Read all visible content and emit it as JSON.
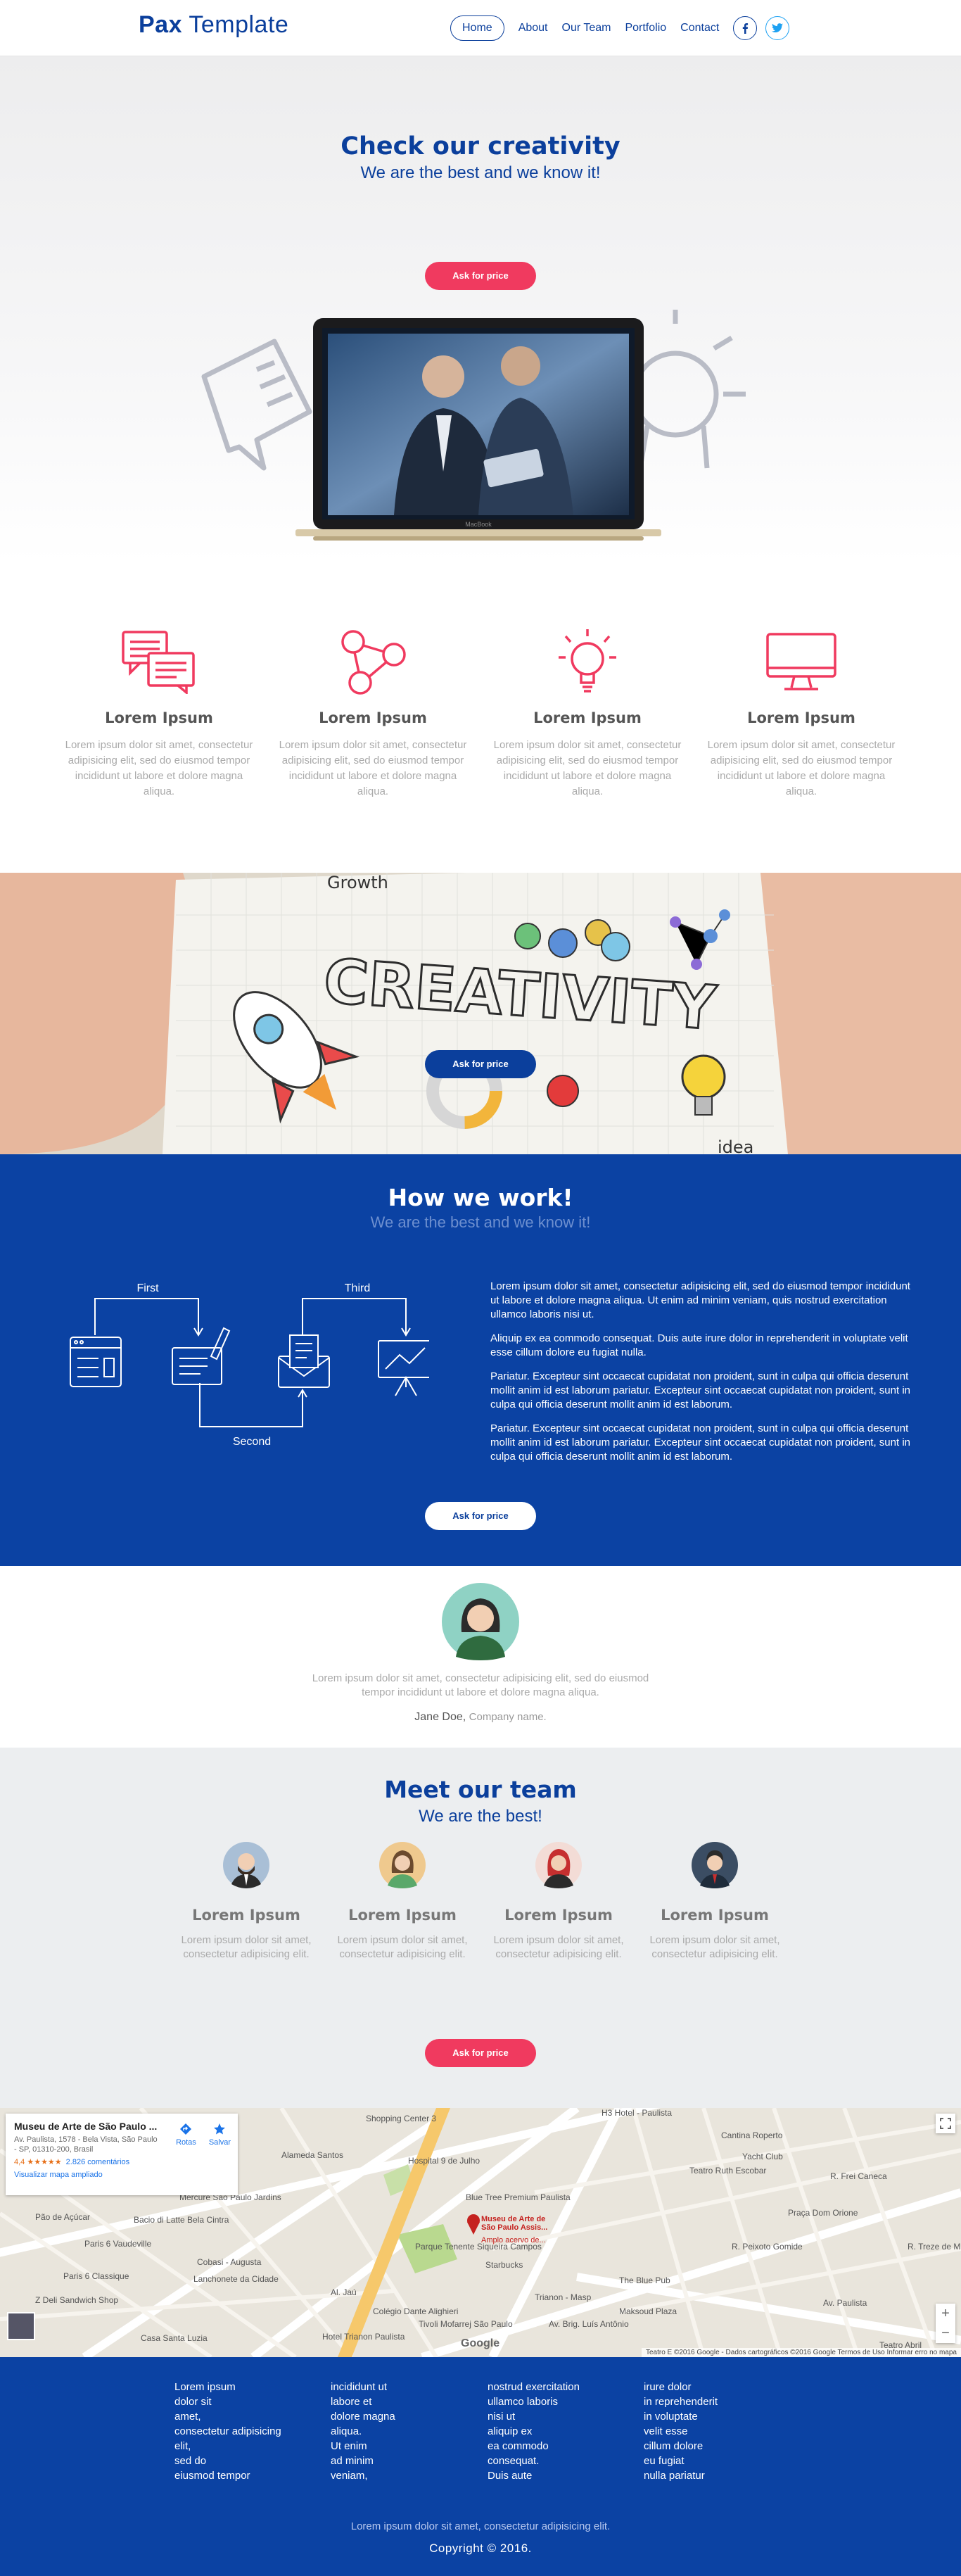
{
  "nav": {
    "logo_bold": "Pax",
    "logo_light": "Template",
    "items": [
      {
        "label": "Home"
      },
      {
        "label": "About"
      },
      {
        "label": "Our Team"
      },
      {
        "label": "Portfolio"
      },
      {
        "label": "Contact"
      }
    ],
    "social": [
      "facebook-icon",
      "twitter-icon"
    ]
  },
  "hero": {
    "title": "Check our creativity",
    "subtitle": "We are the best and we know it!",
    "cta": "Ask for price",
    "laptop_brand": "MacBook"
  },
  "features": [
    {
      "icon": "chat-bubbles-icon",
      "title": "Lorem Ipsum",
      "text": "Lorem ipsum dolor sit amet, consectetur adipisicing elit, sed do eiusmod tempor incididunt ut labore et dolore magna aliqua."
    },
    {
      "icon": "share-nodes-icon",
      "title": "Lorem Ipsum",
      "text": "Lorem ipsum dolor sit amet, consectetur adipisicing elit, sed do eiusmod tempor incididunt ut labore et dolore magna aliqua."
    },
    {
      "icon": "lightbulb-icon",
      "title": "Lorem Ipsum",
      "text": "Lorem ipsum dolor sit amet, consectetur adipisicing elit, sed do eiusmod tempor incididunt ut labore et dolore magna aliqua."
    },
    {
      "icon": "monitor-icon",
      "title": "Lorem Ipsum",
      "text": "Lorem ipsum dolor sit amet, consectetur adipisicing elit, sed do eiusmod tempor incididunt ut labore et dolore magna aliqua."
    }
  ],
  "banner": {
    "word": "CREATIVITY",
    "corner_word": "Growth",
    "corner_word_2": "idea",
    "cta": "Ask for price"
  },
  "how": {
    "title": "How we work!",
    "subtitle": "We are the best and we know it!",
    "steps": {
      "first": "First",
      "second": "Second",
      "third": "Third"
    },
    "paragraphs": [
      "Lorem ipsum dolor sit amet, consectetur adipisicing elit, sed do eiusmod tempor incididunt ut labore et dolore magna aliqua. Ut enim ad minim veniam, quis nostrud exercitation ullamco laboris nisi ut.",
      "Aliquip ex ea commodo consequat. Duis aute irure dolor in reprehenderit in voluptate velit esse cillum dolore eu fugiat nulla.",
      "Pariatur. Excepteur sint occaecat cupidatat non proident, sunt in culpa qui officia deserunt mollit anim id est laborum pariatur. Excepteur sint occaecat cupidatat non proident, sunt in culpa qui officia deserunt mollit anim id est laborum.",
      "Pariatur. Excepteur sint occaecat cupidatat non proident, sunt in culpa qui officia deserunt mollit anim id est laborum pariatur. Excepteur sint occaecat cupidatat non proident, sunt in culpa qui officia deserunt mollit anim id est laborum."
    ],
    "cta": "Ask for price"
  },
  "testimonial": {
    "quote": "Lorem ipsum dolor sit amet, consectetur adipisicing elit, sed do eiusmod tempor incididunt ut labore et dolore magna aliqua.",
    "name": "Jane Doe",
    "company": "Company name."
  },
  "team": {
    "title": "Meet our team",
    "subtitle": "We are the best!",
    "members": [
      {
        "name": "Lorem Ipsum",
        "text": "Lorem ipsum dolor sit amet, consectetur adipisicing elit."
      },
      {
        "name": "Lorem Ipsum",
        "text": "Lorem ipsum dolor sit amet, consectetur adipisicing elit."
      },
      {
        "name": "Lorem Ipsum",
        "text": "Lorem ipsum dolor sit amet, consectetur adipisicing elit."
      },
      {
        "name": "Lorem Ipsum",
        "text": "Lorem ipsum dolor sit amet, consectetur adipisicing elit."
      }
    ],
    "cta": "Ask for price"
  },
  "map": {
    "place_title": "Museu de Arte de São Paulo ...",
    "address": "Av. Paulista, 1578 - Bela Vista, São Paulo - SP, 01310-200, Brasil",
    "rating": "4,4 ★★★★★",
    "reviews": "2.826 comentários",
    "larger_map": "Visualizar mapa ampliado",
    "directions": "Rotas",
    "save": "Salvar",
    "marker_label": "Museu de Arte de São Paulo Assis...",
    "marker_sub": "Amplo acervo de...",
    "labels": [
      "Shopping Center 3",
      "H3 Hotel - Paulista",
      "Cantina Roperto",
      "Hospital 9 de Julho",
      "Yacht Club",
      "Teatro Ruth Escobar",
      "Mercure São Paulo Jardins",
      "Blue Tree Premium Paulista",
      "Praça Dom Orione",
      "Bacio di Latte Bela Cintra",
      "Pão de Açúcar",
      "Paris 6 Vaudeville",
      "Parque Tenente Siqueira Campos",
      "Cobasi - Augusta",
      "Starbucks",
      "Paris 6 Classique",
      "Lanchonete da Cidade",
      "Trianon - Masp",
      "The Blue Pub",
      "Z Deli Sandwich Shop",
      "Colégio Dante Alighieri",
      "Maksoud Plaza",
      "Hotel Trianon Paulista",
      "Casa Santa Luzia",
      "Tivoli Mofarrej São Paulo",
      "Teatro Abril",
      "Al. Jaú",
      "Av. Paulista",
      "Alameda Santos",
      "R. Peixoto Gomide",
      "R. Frei Caneca",
      "Av. Brig. Luís Antônio",
      "R. Treze de Maio"
    ],
    "attribution": "Teatro E  ©2016 Google - Dados cartográficos ©2016 Google   Termos de Uso   Informar erro no mapa",
    "google": "Google"
  },
  "footer": {
    "columns": [
      [
        "Lorem ipsum",
        "dolor sit",
        "amet,",
        "consectetur adipisicing",
        "elit,",
        "sed do",
        "eiusmod tempor"
      ],
      [
        "incididunt ut",
        "labore et",
        "dolore magna",
        "aliqua.",
        "Ut enim",
        "ad minim",
        "veniam,"
      ],
      [
        "nostrud exercitation",
        "ullamco laboris",
        "nisi ut",
        "aliquip ex",
        "ea commodo",
        "consequat.",
        "Duis aute"
      ],
      [
        "irure dolor",
        "in reprehenderit",
        "in voluptate",
        "velit esse",
        "cillum dolore",
        "eu fugiat",
        "nulla pariatur"
      ]
    ],
    "lorem": "Lorem ipsum dolor sit amet, consectetur adipisicing elit.",
    "copyright": "Copyright © 2016."
  },
  "colors": {
    "brand_blue": "#0b3f9c",
    "accent_red": "#f03a5f",
    "section_blue": "#0b42a3"
  }
}
